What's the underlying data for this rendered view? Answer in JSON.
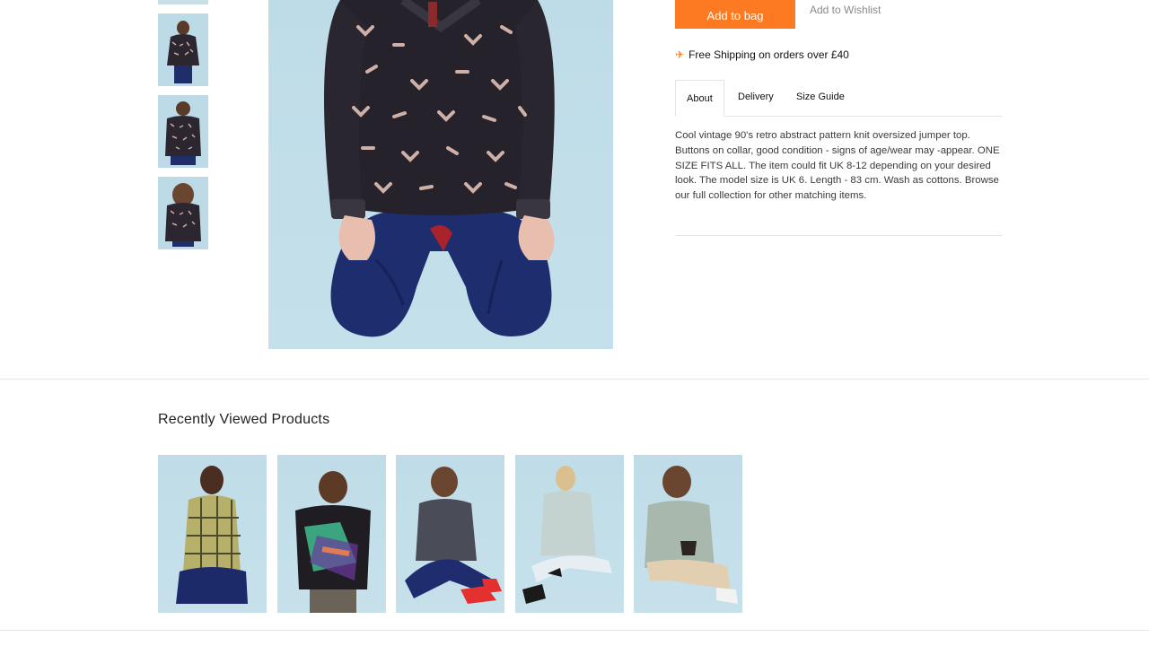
{
  "product": {
    "add_to_bag_label": "Add to bag",
    "wishlist_label": "Add to Wishlist",
    "shipping_icon": "plane-icon",
    "shipping_text": "Free Shipping on orders over £40",
    "tabs": [
      {
        "label": "About",
        "active": true
      },
      {
        "label": "Delivery",
        "active": false
      },
      {
        "label": "Size Guide",
        "active": false
      }
    ],
    "description": "Cool vintage 90's retro abstract pattern knit oversized jumper top. Buttons on collar, good condition - signs of age/wear may -appear. ONE SIZE FITS ALL. The item could fit UK 8-12 depending on your desired look. The model size is UK 6. Length - 83 cm. Wash as cottons. Browse our full collection for other matching items."
  },
  "recently_viewed": {
    "title": "Recently Viewed Products"
  },
  "colors": {
    "accent": "#fd7a22",
    "photo_background": "#c0dde8"
  }
}
